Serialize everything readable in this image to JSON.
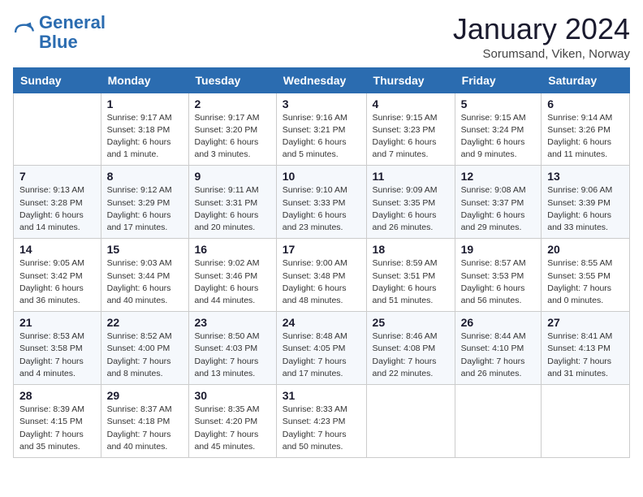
{
  "header": {
    "logo_general": "General",
    "logo_blue": "Blue",
    "month_title": "January 2024",
    "location": "Sorumsand, Viken, Norway"
  },
  "columns": [
    "Sunday",
    "Monday",
    "Tuesday",
    "Wednesday",
    "Thursday",
    "Friday",
    "Saturday"
  ],
  "weeks": [
    [
      {
        "day": "",
        "info": ""
      },
      {
        "day": "1",
        "info": "Sunrise: 9:17 AM\nSunset: 3:18 PM\nDaylight: 6 hours\nand 1 minute."
      },
      {
        "day": "2",
        "info": "Sunrise: 9:17 AM\nSunset: 3:20 PM\nDaylight: 6 hours\nand 3 minutes."
      },
      {
        "day": "3",
        "info": "Sunrise: 9:16 AM\nSunset: 3:21 PM\nDaylight: 6 hours\nand 5 minutes."
      },
      {
        "day": "4",
        "info": "Sunrise: 9:15 AM\nSunset: 3:23 PM\nDaylight: 6 hours\nand 7 minutes."
      },
      {
        "day": "5",
        "info": "Sunrise: 9:15 AM\nSunset: 3:24 PM\nDaylight: 6 hours\nand 9 minutes."
      },
      {
        "day": "6",
        "info": "Sunrise: 9:14 AM\nSunset: 3:26 PM\nDaylight: 6 hours\nand 11 minutes."
      }
    ],
    [
      {
        "day": "7",
        "info": "Sunrise: 9:13 AM\nSunset: 3:28 PM\nDaylight: 6 hours\nand 14 minutes."
      },
      {
        "day": "8",
        "info": "Sunrise: 9:12 AM\nSunset: 3:29 PM\nDaylight: 6 hours\nand 17 minutes."
      },
      {
        "day": "9",
        "info": "Sunrise: 9:11 AM\nSunset: 3:31 PM\nDaylight: 6 hours\nand 20 minutes."
      },
      {
        "day": "10",
        "info": "Sunrise: 9:10 AM\nSunset: 3:33 PM\nDaylight: 6 hours\nand 23 minutes."
      },
      {
        "day": "11",
        "info": "Sunrise: 9:09 AM\nSunset: 3:35 PM\nDaylight: 6 hours\nand 26 minutes."
      },
      {
        "day": "12",
        "info": "Sunrise: 9:08 AM\nSunset: 3:37 PM\nDaylight: 6 hours\nand 29 minutes."
      },
      {
        "day": "13",
        "info": "Sunrise: 9:06 AM\nSunset: 3:39 PM\nDaylight: 6 hours\nand 33 minutes."
      }
    ],
    [
      {
        "day": "14",
        "info": "Sunrise: 9:05 AM\nSunset: 3:42 PM\nDaylight: 6 hours\nand 36 minutes."
      },
      {
        "day": "15",
        "info": "Sunrise: 9:03 AM\nSunset: 3:44 PM\nDaylight: 6 hours\nand 40 minutes."
      },
      {
        "day": "16",
        "info": "Sunrise: 9:02 AM\nSunset: 3:46 PM\nDaylight: 6 hours\nand 44 minutes."
      },
      {
        "day": "17",
        "info": "Sunrise: 9:00 AM\nSunset: 3:48 PM\nDaylight: 6 hours\nand 48 minutes."
      },
      {
        "day": "18",
        "info": "Sunrise: 8:59 AM\nSunset: 3:51 PM\nDaylight: 6 hours\nand 51 minutes."
      },
      {
        "day": "19",
        "info": "Sunrise: 8:57 AM\nSunset: 3:53 PM\nDaylight: 6 hours\nand 56 minutes."
      },
      {
        "day": "20",
        "info": "Sunrise: 8:55 AM\nSunset: 3:55 PM\nDaylight: 7 hours\nand 0 minutes."
      }
    ],
    [
      {
        "day": "21",
        "info": "Sunrise: 8:53 AM\nSunset: 3:58 PM\nDaylight: 7 hours\nand 4 minutes."
      },
      {
        "day": "22",
        "info": "Sunrise: 8:52 AM\nSunset: 4:00 PM\nDaylight: 7 hours\nand 8 minutes."
      },
      {
        "day": "23",
        "info": "Sunrise: 8:50 AM\nSunset: 4:03 PM\nDaylight: 7 hours\nand 13 minutes."
      },
      {
        "day": "24",
        "info": "Sunrise: 8:48 AM\nSunset: 4:05 PM\nDaylight: 7 hours\nand 17 minutes."
      },
      {
        "day": "25",
        "info": "Sunrise: 8:46 AM\nSunset: 4:08 PM\nDaylight: 7 hours\nand 22 minutes."
      },
      {
        "day": "26",
        "info": "Sunrise: 8:44 AM\nSunset: 4:10 PM\nDaylight: 7 hours\nand 26 minutes."
      },
      {
        "day": "27",
        "info": "Sunrise: 8:41 AM\nSunset: 4:13 PM\nDaylight: 7 hours\nand 31 minutes."
      }
    ],
    [
      {
        "day": "28",
        "info": "Sunrise: 8:39 AM\nSunset: 4:15 PM\nDaylight: 7 hours\nand 35 minutes."
      },
      {
        "day": "29",
        "info": "Sunrise: 8:37 AM\nSunset: 4:18 PM\nDaylight: 7 hours\nand 40 minutes."
      },
      {
        "day": "30",
        "info": "Sunrise: 8:35 AM\nSunset: 4:20 PM\nDaylight: 7 hours\nand 45 minutes."
      },
      {
        "day": "31",
        "info": "Sunrise: 8:33 AM\nSunset: 4:23 PM\nDaylight: 7 hours\nand 50 minutes."
      },
      {
        "day": "",
        "info": ""
      },
      {
        "day": "",
        "info": ""
      },
      {
        "day": "",
        "info": ""
      }
    ]
  ]
}
